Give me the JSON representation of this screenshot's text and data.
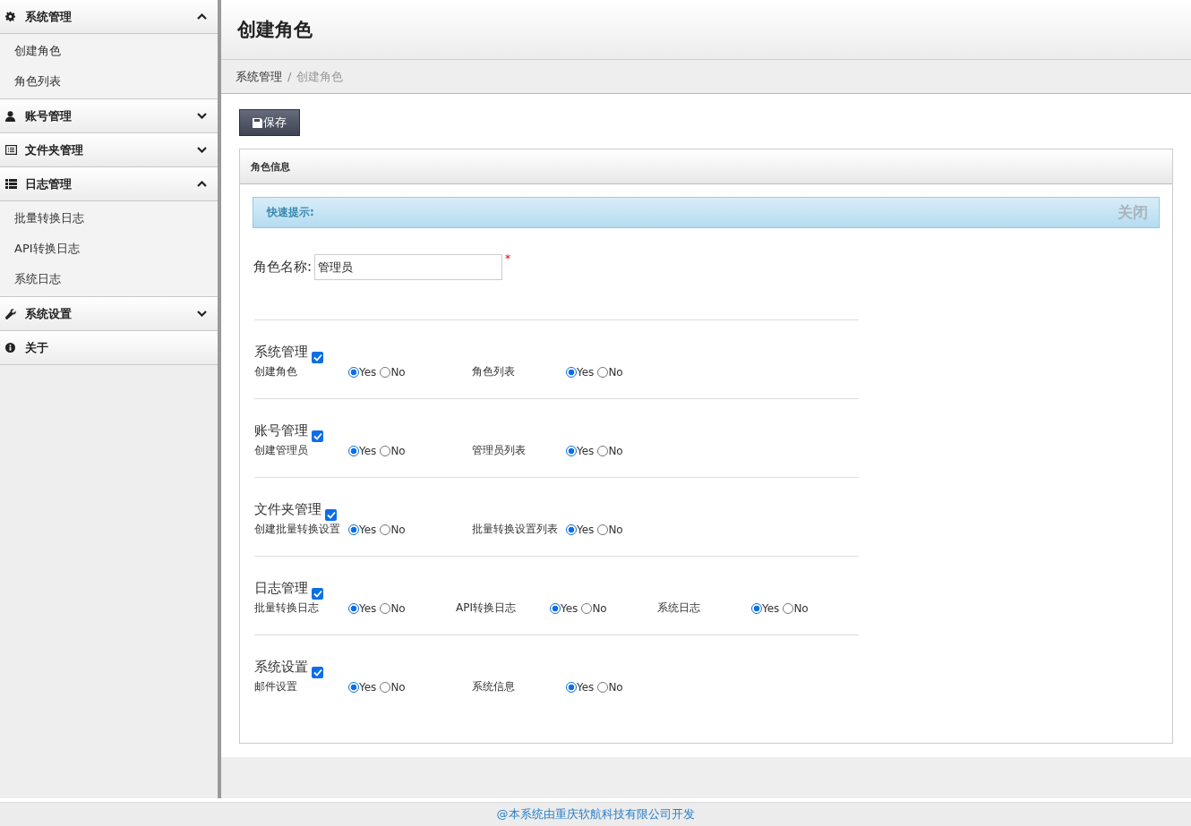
{
  "sidebar": {
    "groups": [
      {
        "label": "系统管理",
        "expanded": true,
        "children": [
          {
            "label": "创建角色"
          },
          {
            "label": "角色列表"
          }
        ]
      },
      {
        "label": "账号管理",
        "expanded": false
      },
      {
        "label": "文件夹管理",
        "expanded": false
      },
      {
        "label": "日志管理",
        "expanded": true,
        "children": [
          {
            "label": "批量转换日志"
          },
          {
            "label": "API转换日志"
          },
          {
            "label": "系统日志"
          }
        ]
      },
      {
        "label": "系统设置",
        "expanded": false
      },
      {
        "label": "关于"
      }
    ]
  },
  "page": {
    "title": "创建角色",
    "breadcrumb": [
      {
        "label": "系统管理"
      },
      {
        "label": "创建角色"
      }
    ],
    "breadcrumb_separator": "/"
  },
  "save_button": "保存",
  "panel": {
    "title": "角色信息",
    "alert": {
      "text": "快速提示:",
      "close": "关闭"
    },
    "role_name": {
      "label": "角色名称:",
      "value": "管理员",
      "required_mark": "*"
    },
    "groups": [
      {
        "title": "系统管理",
        "checked": true,
        "items": [
          {
            "label": "创建角色",
            "options": [
              {
                "label": "Yes",
                "selected": true
              },
              {
                "label": "No",
                "selected": false
              }
            ]
          },
          {
            "label": "角色列表",
            "options": [
              {
                "label": "Yes",
                "selected": true
              },
              {
                "label": "No",
                "selected": false
              }
            ]
          }
        ]
      },
      {
        "title": "账号管理",
        "checked": true,
        "items": [
          {
            "label": "创建管理员",
            "options": [
              {
                "label": "Yes",
                "selected": true
              },
              {
                "label": "No",
                "selected": false
              }
            ]
          },
          {
            "label": "管理员列表",
            "options": [
              {
                "label": "Yes",
                "selected": true
              },
              {
                "label": "No",
                "selected": false
              }
            ]
          }
        ]
      },
      {
        "title": "文件夹管理",
        "checked": true,
        "items": [
          {
            "label": "创建批量转换设置",
            "options": [
              {
                "label": "Yes",
                "selected": true
              },
              {
                "label": "No",
                "selected": false
              }
            ]
          },
          {
            "label": "批量转换设置列表",
            "options": [
              {
                "label": "Yes",
                "selected": true
              },
              {
                "label": "No",
                "selected": false
              }
            ]
          }
        ]
      },
      {
        "title": "日志管理",
        "checked": true,
        "items": [
          {
            "label": "批量转换日志",
            "options": [
              {
                "label": "Yes",
                "selected": true
              },
              {
                "label": "No",
                "selected": false
              }
            ]
          },
          {
            "label": "API转换日志",
            "options": [
              {
                "label": "Yes",
                "selected": true
              },
              {
                "label": "No",
                "selected": false
              }
            ]
          },
          {
            "label": "系统日志",
            "options": [
              {
                "label": "Yes",
                "selected": true
              },
              {
                "label": "No",
                "selected": false
              }
            ]
          }
        ]
      },
      {
        "title": "系统设置",
        "checked": true,
        "items": [
          {
            "label": "邮件设置",
            "options": [
              {
                "label": "Yes",
                "selected": true
              },
              {
                "label": "No",
                "selected": false
              }
            ]
          },
          {
            "label": "系统信息",
            "options": [
              {
                "label": "Yes",
                "selected": true
              },
              {
                "label": "No",
                "selected": false
              }
            ]
          }
        ]
      }
    ]
  },
  "footer": "@本系统由重庆软航科技有限公司开发"
}
